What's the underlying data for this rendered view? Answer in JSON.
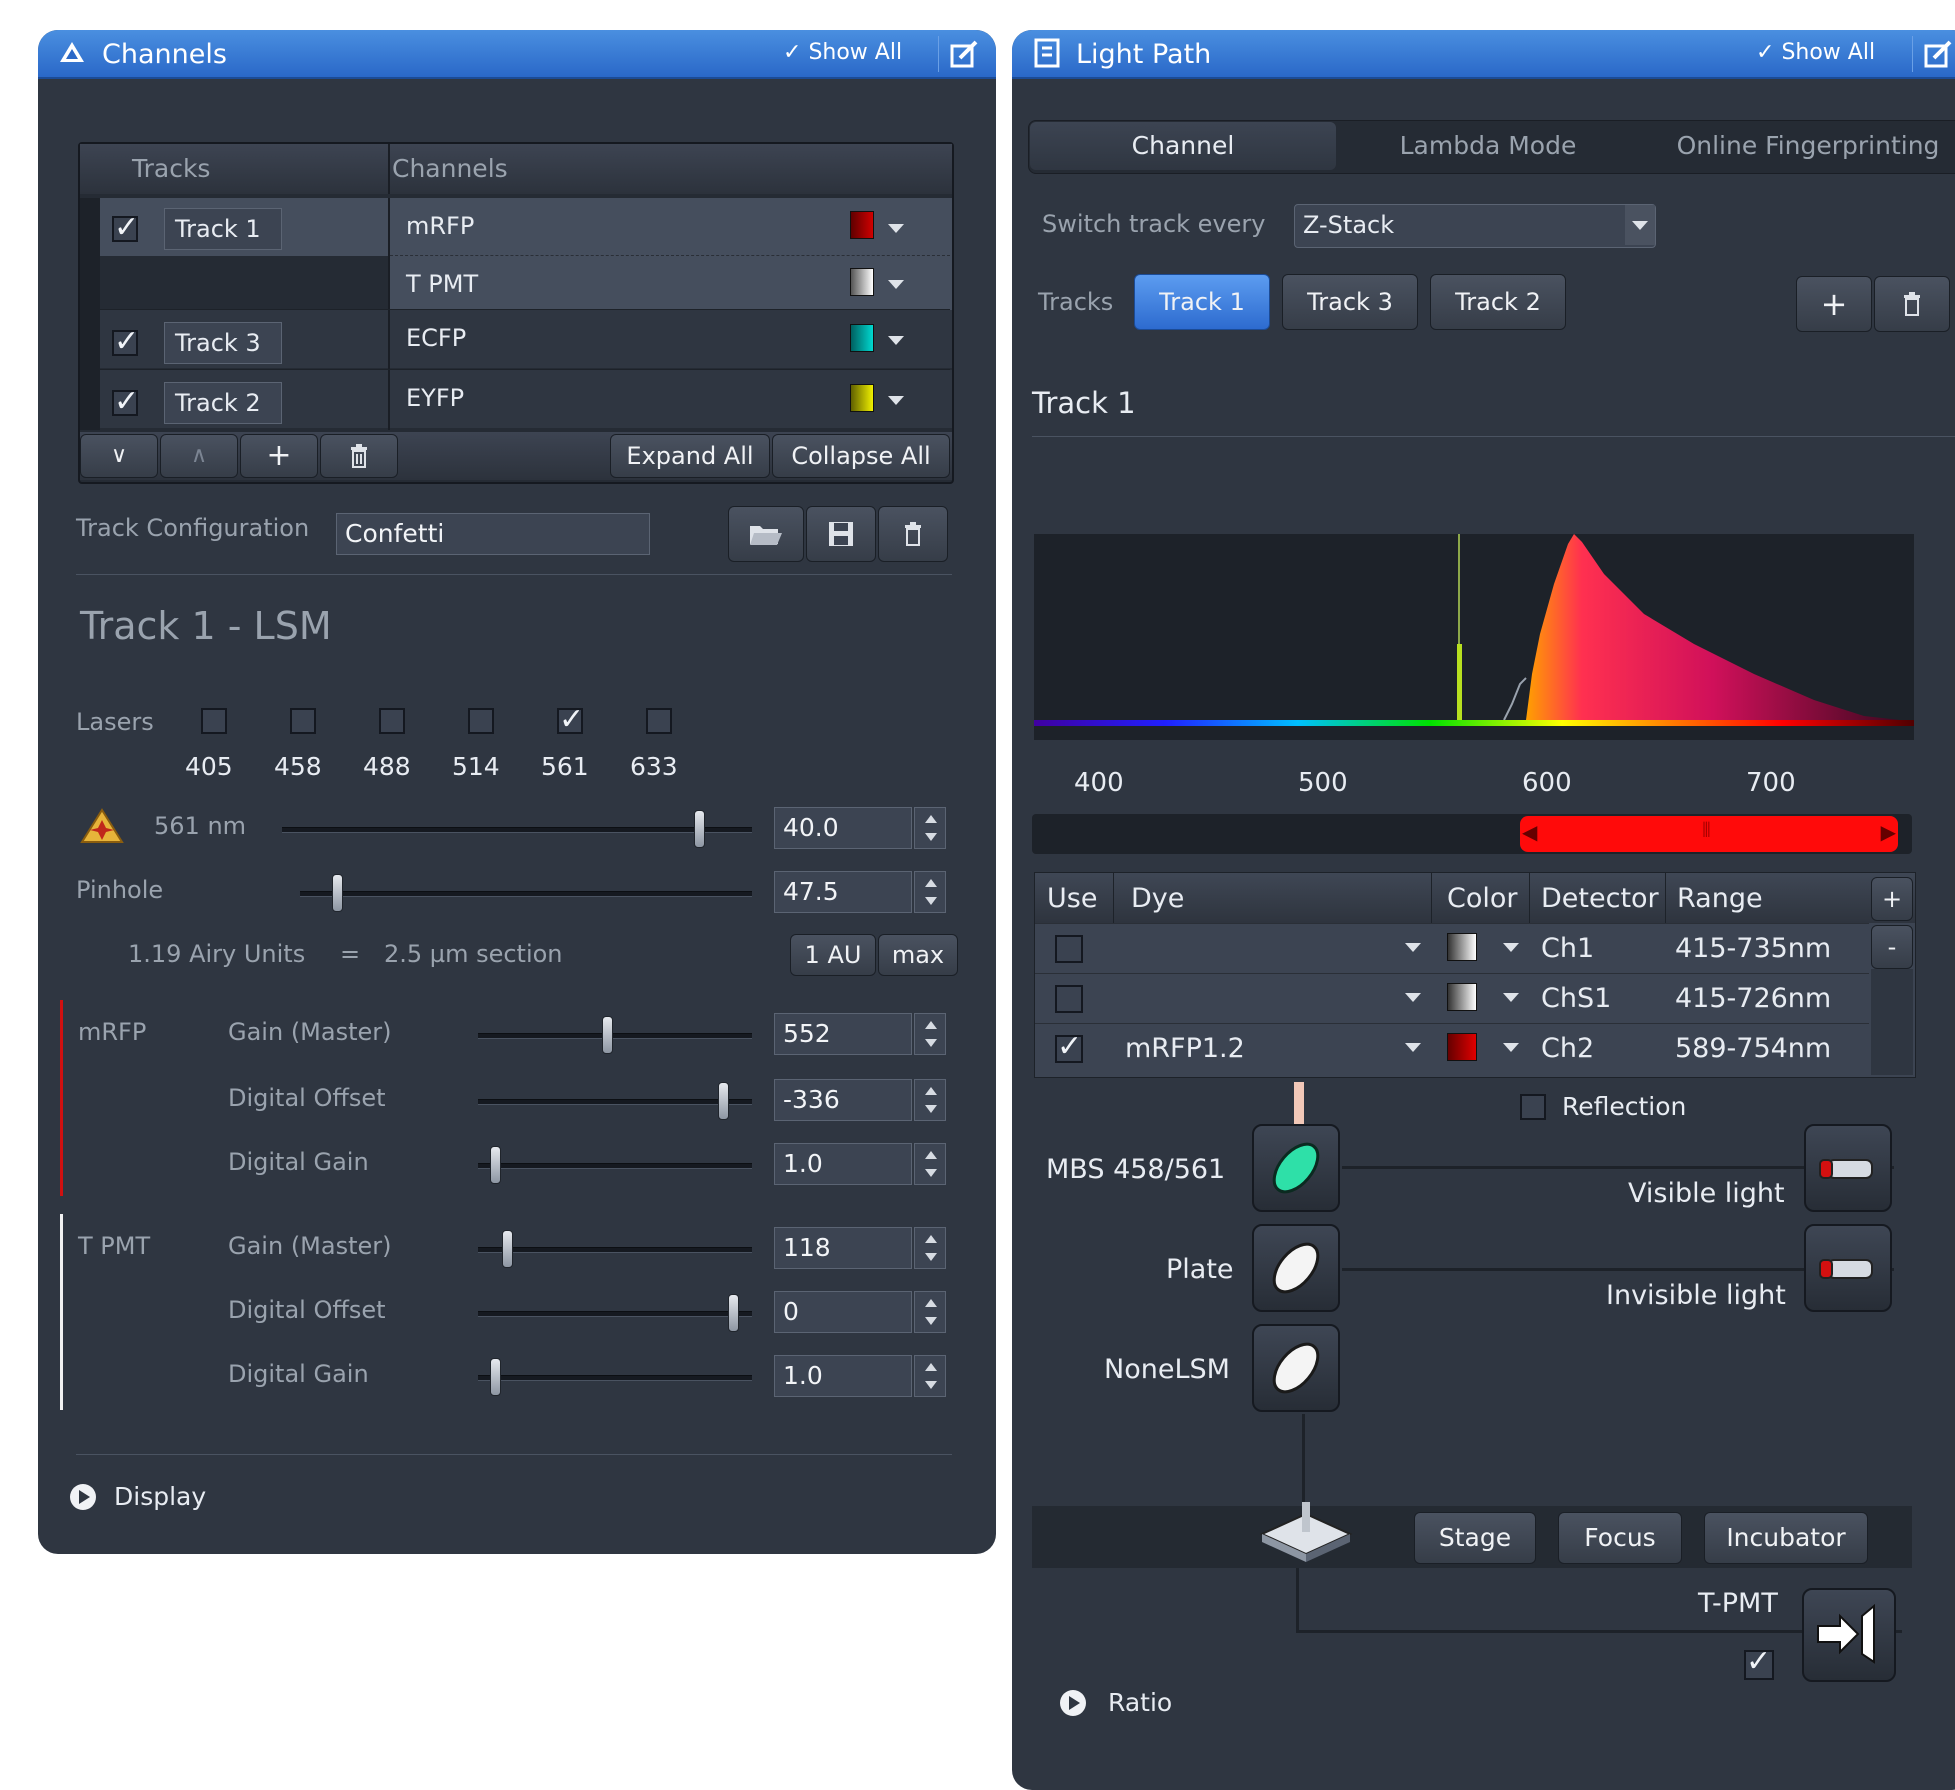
{
  "channels_panel": {
    "title": "Channels",
    "show_all": "Show All",
    "table": {
      "headers": [
        "Tracks",
        "Channels"
      ],
      "rows": [
        {
          "track": "Track 1",
          "channel": "mRFP",
          "color": "#b00000"
        },
        {
          "track": "",
          "channel": "T PMT",
          "color": "#e8e8e8"
        },
        {
          "track": "Track 3",
          "channel": "ECFP",
          "color": "#00b8b0"
        },
        {
          "track": "Track 2",
          "channel": "EYFP",
          "color": "#d8d800"
        }
      ],
      "expand_all": "Expand All",
      "collapse_all": "Collapse All"
    },
    "track_configuration_label": "Track Configuration",
    "track_configuration_value": "Confetti",
    "section_title": "Track 1 - LSM",
    "lasers_label": "Lasers",
    "lasers": [
      {
        "wavelength": "405",
        "checked": false
      },
      {
        "wavelength": "458",
        "checked": false
      },
      {
        "wavelength": "488",
        "checked": false
      },
      {
        "wavelength": "514",
        "checked": false
      },
      {
        "wavelength": "561",
        "checked": true
      },
      {
        "wavelength": "633",
        "checked": false
      }
    ],
    "laser_line_label": "561 nm",
    "laser_power": "40.0",
    "pinhole_label": "Pinhole",
    "pinhole_value": "47.5",
    "airy_text": "1.19 Airy Units",
    "airy_equals": "=",
    "section_text": "2.5 µm section",
    "au_button": "1 AU",
    "max_button": "max",
    "mrfp": {
      "name": "mRFP",
      "gain_label": "Gain (Master)",
      "gain": "552",
      "offset_label": "Digital Offset",
      "offset": "-336",
      "dgain_label": "Digital Gain",
      "dgain": "1.0"
    },
    "tpmt": {
      "name": "T PMT",
      "gain_label": "Gain (Master)",
      "gain": "118",
      "offset_label": "Digital Offset",
      "offset": "0",
      "dgain_label": "Digital Gain",
      "dgain": "1.0"
    },
    "display_label": "Display"
  },
  "lightpath_panel": {
    "title": "Light Path",
    "show_all": "Show All",
    "tabs": [
      "Channel",
      "Lambda Mode",
      "Online Fingerprinting"
    ],
    "switch_track_label": "Switch track every",
    "switch_track_value": "Z-Stack",
    "tracks_label": "Tracks",
    "tracks": [
      "Track 1",
      "Track 3",
      "Track 2"
    ],
    "track_heading": "Track 1",
    "spectrum_ticks": [
      "400",
      "500",
      "600",
      "700"
    ],
    "detector_table": {
      "headers": [
        "Use",
        "Dye",
        "Color",
        "Detector",
        "Range"
      ],
      "add": "+",
      "remove": "-",
      "rows": [
        {
          "use": false,
          "dye": "",
          "color": "#d9d9d9",
          "detector": "Ch1",
          "range": "415-735nm"
        },
        {
          "use": false,
          "dye": "",
          "color": "#d9d9d9",
          "detector": "ChS1",
          "range": "415-726nm"
        },
        {
          "use": true,
          "dye": "mRFP1.2",
          "color": "#c00000",
          "detector": "Ch2",
          "range": "589-754nm"
        }
      ]
    },
    "reflection_label": "Reflection",
    "mbs_label": "MBS 458/561",
    "plate_label": "Plate",
    "none_label": "NoneLSM",
    "visible_light": "Visible light",
    "invisible_light": "Invisible light",
    "stage_buttons": [
      "Stage",
      "Focus",
      "Incubator"
    ],
    "tpmt_label": "T-PMT",
    "ratio_label": "Ratio"
  }
}
